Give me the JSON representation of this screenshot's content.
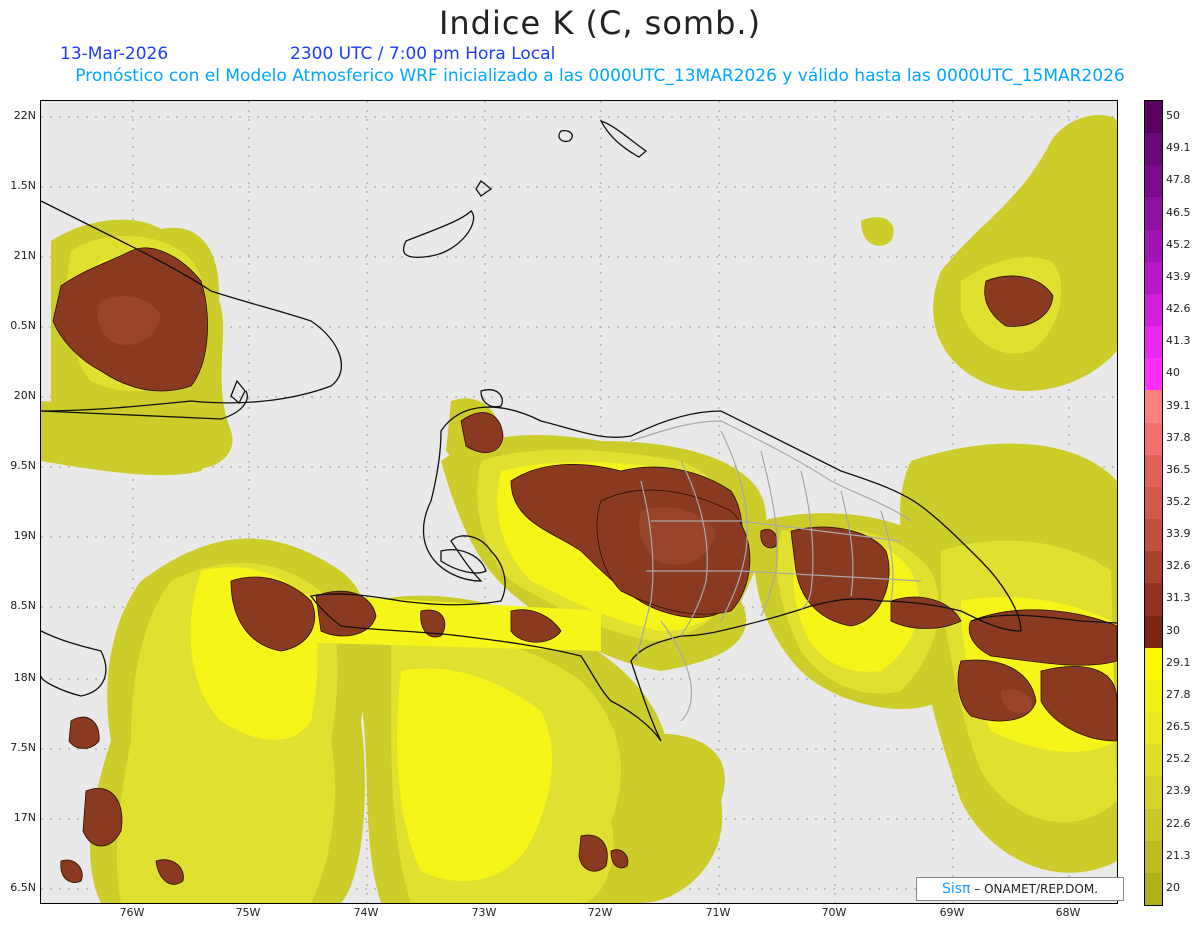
{
  "header": {
    "title": "Indice K (C, somb.)",
    "date": "13-Mar-2026",
    "time": "2300 UTC / 7:00 pm Hora Local",
    "description": "Pronóstico con el Modelo Atmosferico WRF inicializado a las 0000UTC_13MAR2026 y válido hasta las  0000UTC_15MAR2026"
  },
  "axes": {
    "y_labels": [
      "22N",
      "1.5N",
      "21N",
      "0.5N",
      "20N",
      "9.5N",
      "19N",
      "8.5N",
      "18N",
      "7.5N",
      "17N",
      "6.5N"
    ],
    "x_labels": [
      "76W",
      "75W",
      "74W",
      "73W",
      "72W",
      "71W",
      "70W",
      "69W",
      "68W"
    ]
  },
  "legend": {
    "labels": [
      "50",
      "49.1",
      "47.8",
      "46.5",
      "45.2",
      "43.9",
      "42.6",
      "41.3",
      "40",
      "39.1",
      "37.8",
      "36.5",
      "35.2",
      "33.9",
      "32.6",
      "31.3",
      "30",
      "29.1",
      "27.8",
      "26.5",
      "25.2",
      "23.9",
      "22.6",
      "21.3",
      "20"
    ],
    "colors": [
      "#5a0060",
      "#6a0a78",
      "#7c0a8c",
      "#8e10a0",
      "#a014b4",
      "#b818c8",
      "#d020dc",
      "#e828ec",
      "#ff30ff",
      "#ff7f7f",
      "#f47070",
      "#e06258",
      "#d05a4c",
      "#bf5040",
      "#a8402e",
      "#913222",
      "#7a2612",
      "#fafa00",
      "#f2f214",
      "#eaea1e",
      "#e0e028",
      "#d4d42a",
      "#c8c828",
      "#bcbc20",
      "#b0b018"
    ]
  },
  "credit": {
    "logo": "Sisπ",
    "text": "– ONAMET/REP.DOM."
  },
  "colors": {
    "background": "#e9e9e9",
    "yellow_light": "#eeee2a",
    "yellow_mid": "#dede30",
    "yellow_dark": "#c9c92a",
    "brown": "#8a3a20",
    "brown_dark": "#6e2a14"
  }
}
